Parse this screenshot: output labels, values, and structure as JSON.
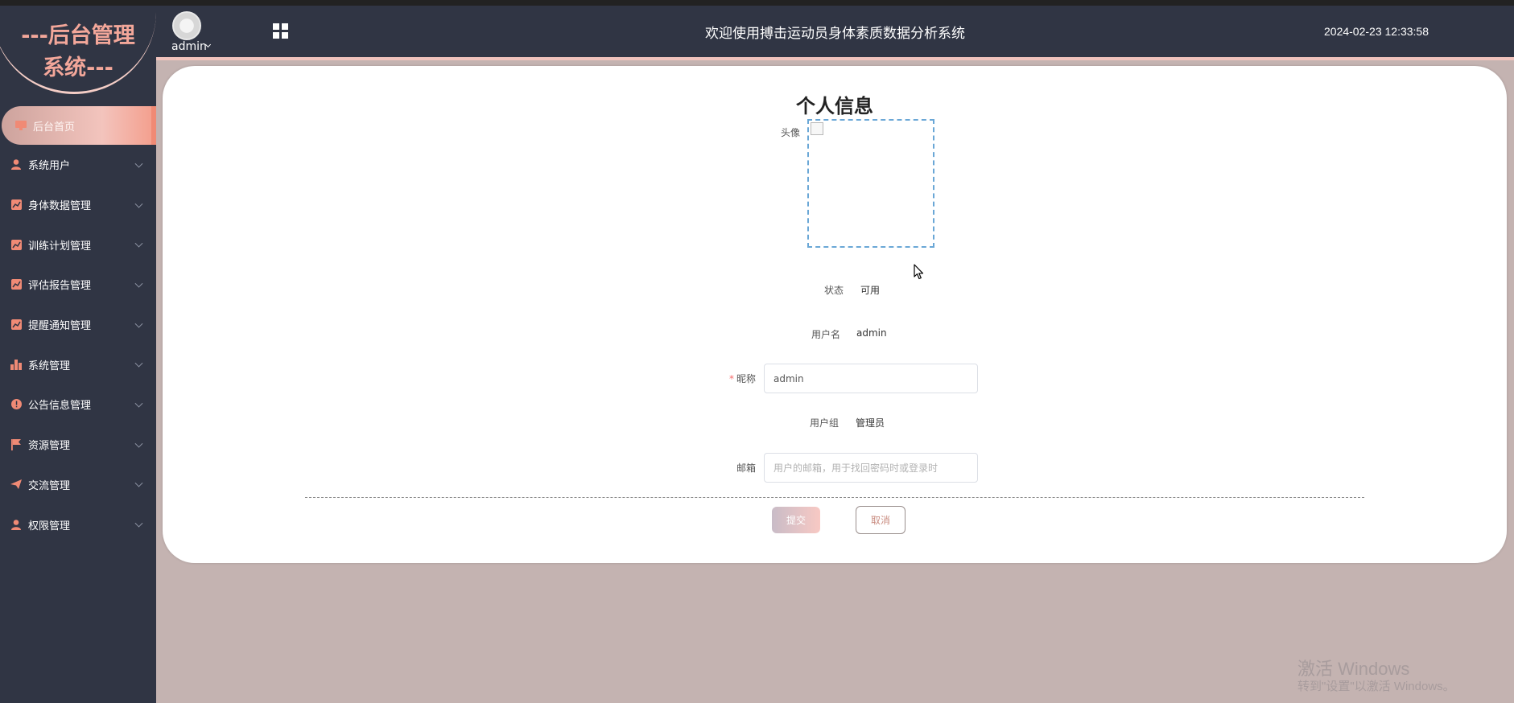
{
  "sidebar": {
    "logo_line1": "---后台管理",
    "logo_line2": "系统---",
    "items": [
      {
        "label": "后台首页",
        "icon": "monitor-icon",
        "active": true
      },
      {
        "label": "系统用户",
        "icon": "user-icon"
      },
      {
        "label": "身体数据管理",
        "icon": "chart-icon"
      },
      {
        "label": "训练计划管理",
        "icon": "chart-icon"
      },
      {
        "label": "评估报告管理",
        "icon": "chart-icon"
      },
      {
        "label": "提醒通知管理",
        "icon": "chart-icon"
      },
      {
        "label": "系统管理",
        "icon": "bar-chart-icon"
      },
      {
        "label": "公告信息管理",
        "icon": "info-icon"
      },
      {
        "label": "资源管理",
        "icon": "flag-icon"
      },
      {
        "label": "交流管理",
        "icon": "send-icon"
      },
      {
        "label": "权限管理",
        "icon": "user-icon"
      }
    ]
  },
  "header": {
    "username": "admin",
    "title": "欢迎使用搏击运动员身体素质数据分析系统",
    "datetime": "2024-02-23 12:33:58"
  },
  "form": {
    "title": "个人信息",
    "avatar_label": "头像",
    "status_label": "状态",
    "status_value": "可用",
    "username_label": "用户名",
    "username_value": "admin",
    "nickname_label": "昵称",
    "nickname_value": "admin",
    "group_label": "用户组",
    "group_value": "管理员",
    "email_label": "邮箱",
    "email_placeholder": "用户的邮箱，用于找回密码时或登录时",
    "submit_label": "提交",
    "cancel_label": "取消"
  },
  "watermark": {
    "line1": "激活 Windows",
    "line2": "转到\"设置\"以激活 Windows。"
  },
  "colors": {
    "sidebar_bg": "#303544",
    "accent": "#f08a75",
    "page_bg": "#c4b3b1"
  }
}
